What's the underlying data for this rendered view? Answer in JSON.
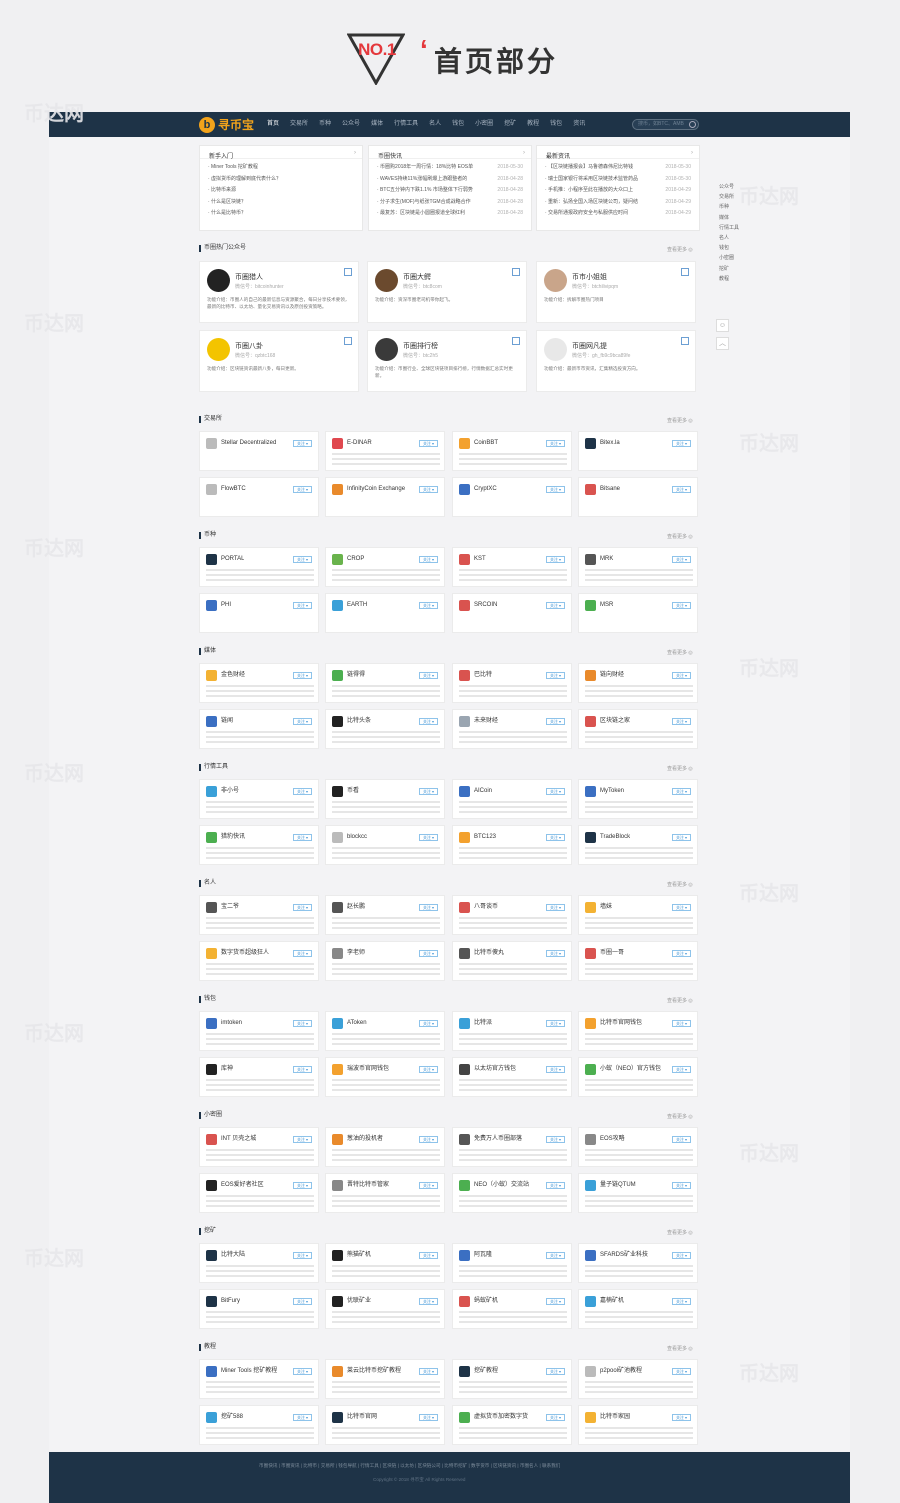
{
  "hero": {
    "badge": "NO.1",
    "quote": "‘",
    "title": "首页部分"
  },
  "nav": {
    "logo_text": "寻币宝",
    "links": [
      "首页",
      "交易所",
      "币种",
      "公众号",
      "媒体",
      "行情工具",
      "名人",
      "钱包",
      "小密圈",
      "挖矿",
      "教程",
      "钱包",
      "资讯"
    ],
    "search_placeholder": "搜币，如BTC、AMB"
  },
  "news": [
    {
      "title": "新手入门",
      "items": [
        {
          "t": "Miner Tools 挖矿教程",
          "d": ""
        },
        {
          "t": "虚拟货币的理解到底代表什么？",
          "d": ""
        },
        {
          "t": "比特币来源",
          "d": ""
        },
        {
          "t": "什么是区块链？",
          "d": ""
        },
        {
          "t": "什么是比特币？",
          "d": ""
        }
      ]
    },
    {
      "title": "币圈快讯",
      "items": [
        {
          "t": "币圈购2018年一周行情：18%比特 EOS单",
          "d": "2018-05-30"
        },
        {
          "t": "WAVES持续11%涨幅刷爆上游跟整者的",
          "d": "2018-04-28"
        },
        {
          "t": "BTC五分钟内下跌1.1% 市场整体下行弱势",
          "d": "2018-04-28"
        },
        {
          "t": "分子求生(MOF)与纸张TGM合成战略合作",
          "d": "2018-04-28"
        },
        {
          "t": "最复苏：区块链是小圆圈报道全球红利",
          "d": "2018-04-28"
        }
      ]
    },
    {
      "title": "最新资讯",
      "items": [
        {
          "t": "【区块链播报会】马鲁德森伟尼比特钱",
          "d": "2018-05-30"
        },
        {
          "t": "瑞士国家银行将采用区块链技术监管药品",
          "d": "2018-05-30"
        },
        {
          "t": "手机推：小程序至此在播放的大众口上",
          "d": "2018-04-29"
        },
        {
          "t": "重新：弘扬全国入场区块链公司，疑问结",
          "d": "2018-04-29"
        },
        {
          "t": "交易所通报政府安全与私服供应时间",
          "d": "2018-04-29"
        }
      ]
    }
  ],
  "right_nav": [
    "公众号",
    "交易所",
    "币种",
    "媒体",
    "行情工具",
    "名人",
    "钱包",
    "小密圈",
    "挖矿",
    "教程"
  ],
  "float_buttons": {
    "wechat": "☺",
    "top": "︿"
  },
  "more_label": "查看更多 ◎",
  "follow_label": "关注 ▾",
  "wechat_section": {
    "title": "币圈热门公众号",
    "accounts": [
      {
        "name": "币圈猎人",
        "id": "微信号：bitcoinhunter",
        "desc": "功能介绍：币圈人的自己的最新信息与资源聚合，每日分享技术要领，最新的比特币、以太坊、量化交易资讯以及原创投资策略。"
      },
      {
        "name": "币圈大鳄",
        "id": "微信号：btc8com",
        "desc": "功能介绍：资深币圈老司机带你起飞。"
      },
      {
        "name": "币市小姐姐",
        "id": "微信号：btchilivipqm",
        "desc": "功能介绍：拆解币圈热门项目"
      },
      {
        "name": "币圈八卦",
        "id": "微信号：qzbtc168",
        "desc": "功能介绍：区块链资讯最新八卦，每日更新。"
      },
      {
        "name": "币圈排行榜",
        "id": "微信号：btc2h5",
        "desc": "功能介绍：币圈行业、全球区块链项目排行榜，行情数据汇总实时更新。"
      },
      {
        "name": "币圈网凡提",
        "id": "微信号：gh_fb9c9bca89fe",
        "desc": "功能介绍：最新币市资讯，汇集精选投资方向。"
      }
    ]
  },
  "sections": [
    {
      "title": "交易所",
      "items": [
        {
          "name": "Stellar Decentralized",
          "color": "#bbbbbb",
          "desc": false
        },
        {
          "name": "E-DINAR",
          "color": "#e0484f",
          "desc": true
        },
        {
          "name": "CoinBBT",
          "color": "#f3a12e",
          "desc": true
        },
        {
          "name": "Bitex.la",
          "color": "#1e3347",
          "desc": false
        },
        {
          "name": "FlowBTC",
          "color": "#bbbbbb",
          "desc": false
        },
        {
          "name": "InfinityCoin Exchange",
          "color": "#e98a2b",
          "desc": false
        },
        {
          "name": "CryptXC",
          "color": "#3b6fc2",
          "desc": false
        },
        {
          "name": "Bitsane",
          "color": "#d9534f",
          "desc": false
        }
      ]
    },
    {
      "title": "币种",
      "items": [
        {
          "name": "PORTAL",
          "color": "#1e3347",
          "desc": true
        },
        {
          "name": "CROP",
          "color": "#69b34c",
          "desc": true
        },
        {
          "name": "KST",
          "color": "#d9534f",
          "desc": true
        },
        {
          "name": "MRK",
          "color": "#555555",
          "desc": true
        },
        {
          "name": "PHI",
          "color": "#3b6fc2",
          "desc": false
        },
        {
          "name": "EARTH",
          "color": "#3aa0d8",
          "desc": false
        },
        {
          "name": "SRCOIN",
          "color": "#d9534f",
          "desc": false
        },
        {
          "name": "MSR",
          "color": "#4caf50",
          "desc": false
        }
      ]
    },
    {
      "title": "媒体",
      "items": [
        {
          "name": "金色财经",
          "color": "#f3b233",
          "desc": true
        },
        {
          "name": "链得得",
          "color": "#4caf50",
          "desc": true
        },
        {
          "name": "巴比特",
          "color": "#d9534f",
          "desc": true
        },
        {
          "name": "链向财经",
          "color": "#e98a2b",
          "desc": true
        },
        {
          "name": "链闻",
          "color": "#3b6fc2",
          "desc": true
        },
        {
          "name": "比特头条",
          "color": "#222222",
          "desc": true
        },
        {
          "name": "未来财经",
          "color": "#9aa5b1",
          "desc": true
        },
        {
          "name": "区块链之家",
          "color": "#d9534f",
          "desc": true
        }
      ]
    },
    {
      "title": "行情工具",
      "items": [
        {
          "name": "非小号",
          "color": "#3aa0d8",
          "desc": true
        },
        {
          "name": "币看",
          "color": "#222222",
          "desc": true
        },
        {
          "name": "AICoin",
          "color": "#3b6fc2",
          "desc": true
        },
        {
          "name": "MyToken",
          "color": "#3b6fc2",
          "desc": true
        },
        {
          "name": "猎豹快讯",
          "color": "#4caf50",
          "desc": true
        },
        {
          "name": "blockcc",
          "color": "#bbbbbb",
          "desc": true
        },
        {
          "name": "BTC123",
          "color": "#f3a12e",
          "desc": true
        },
        {
          "name": "TradeBlock",
          "color": "#1e3347",
          "desc": true
        }
      ]
    },
    {
      "title": "名人",
      "items": [
        {
          "name": "宝二爷",
          "color": "#555555",
          "desc": true
        },
        {
          "name": "赵长鹏",
          "color": "#555555",
          "desc": true
        },
        {
          "name": "八哥谈币",
          "color": "#d9534f",
          "desc": true
        },
        {
          "name": "墙妹",
          "color": "#f3b233",
          "desc": true
        },
        {
          "name": "数字货币超级狂人",
          "color": "#f3b233",
          "desc": true
        },
        {
          "name": "李老师",
          "color": "#888888",
          "desc": true
        },
        {
          "name": "比特币傻丸",
          "color": "#555555",
          "desc": true
        },
        {
          "name": "币圈一哥",
          "color": "#d9534f",
          "desc": true
        }
      ]
    },
    {
      "title": "钱包",
      "items": [
        {
          "name": "imtoken",
          "color": "#3b6fc2",
          "desc": true
        },
        {
          "name": "AToken",
          "color": "#3aa0d8",
          "desc": true
        },
        {
          "name": "比特派",
          "color": "#3aa0d8",
          "desc": true
        },
        {
          "name": "比特币官网钱包",
          "color": "#f3a12e",
          "desc": true
        },
        {
          "name": "库神",
          "color": "#222222",
          "desc": true
        },
        {
          "name": "瑞波币官网钱包",
          "color": "#f3a12e",
          "desc": true
        },
        {
          "name": "以太坊官方钱包",
          "color": "#444444",
          "desc": true
        },
        {
          "name": "小蚁（NEO）官方钱包",
          "color": "#4caf50",
          "desc": true
        }
      ]
    },
    {
      "title": "小密圈",
      "items": [
        {
          "name": "INT 贝壳之城",
          "color": "#d9534f",
          "desc": true
        },
        {
          "name": "葱油的投机者",
          "color": "#e98a2b",
          "desc": true
        },
        {
          "name": "免费万人币圈部落",
          "color": "#555555",
          "desc": true
        },
        {
          "name": "EOS攻略",
          "color": "#888888",
          "desc": true
        },
        {
          "name": "EOS爱好者社区",
          "color": "#222222",
          "desc": true
        },
        {
          "name": "晋特比特币管家",
          "color": "#888888",
          "desc": true
        },
        {
          "name": "NEO（小蚁）交流站",
          "color": "#4caf50",
          "desc": true
        },
        {
          "name": "量子链QTUM",
          "color": "#3aa0d8",
          "desc": true
        }
      ]
    },
    {
      "title": "挖矿",
      "items": [
        {
          "name": "比特大陆",
          "color": "#1e3347",
          "desc": true
        },
        {
          "name": "熊猫矿机",
          "color": "#222222",
          "desc": true
        },
        {
          "name": "阿瓦隆",
          "color": "#3b6fc2",
          "desc": true
        },
        {
          "name": "SFARDS矿业科技",
          "color": "#3b6fc2",
          "desc": true
        },
        {
          "name": "BitFury",
          "color": "#1e3347",
          "desc": true
        },
        {
          "name": "优联矿业",
          "color": "#222222",
          "desc": true
        },
        {
          "name": "蚂蚁矿机",
          "color": "#d9534f",
          "desc": true
        },
        {
          "name": "嘉楠矿机",
          "color": "#3aa0d8",
          "desc": true
        }
      ]
    },
    {
      "title": "教程",
      "items": [
        {
          "name": "Miner Tools 挖矿教程",
          "color": "#3b6fc2",
          "desc": true
        },
        {
          "name": "莱云比特币挖矿教程",
          "color": "#e98a2b",
          "desc": true
        },
        {
          "name": "挖矿教程",
          "color": "#1e3347",
          "desc": true
        },
        {
          "name": "p2pool矿池教程",
          "color": "#bbbbbb",
          "desc": true
        },
        {
          "name": "挖矿588",
          "color": "#3aa0d8",
          "desc": true
        },
        {
          "name": "比特币官网",
          "color": "#1e3347",
          "desc": true
        },
        {
          "name": "虚拟货币加密数字货",
          "color": "#4caf50",
          "desc": true
        },
        {
          "name": "比特币家园",
          "color": "#f3b233",
          "desc": true
        }
      ]
    }
  ],
  "footer": {
    "links": "币圈快讯 | 币圈资讯 | 比特币 | 交易所 | 钱包导航 | 行情工具 | 区块链 | 以太坊 | 区块链公司 | 比特币挖矿 | 数字货币 | 区块链资讯 | 币圈名人 | 联系我们",
    "copyright": "Copyright © 2018 寻币宝 All Rights Reserved"
  },
  "watermark": "币达网"
}
